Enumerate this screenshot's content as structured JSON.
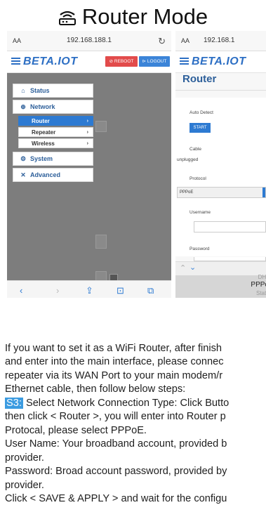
{
  "title": "Router Mode",
  "left_screen": {
    "aa": "AA",
    "url": "192.168.188.1",
    "brand": "BETA.IOT",
    "reboot": "⊘ REBOOT",
    "logout": "⊳ LOGOUT",
    "nav": {
      "status": "Status",
      "network": "Network",
      "router": "Router",
      "repeater": "Repeater",
      "wireless": "Wireless",
      "system": "System",
      "advanced": "Advanced"
    }
  },
  "right_screen": {
    "aa": "AA",
    "url": "192.168.1",
    "brand": "BETA.IOT",
    "page_title": "Router",
    "auto_detect": "Auto Detect",
    "start": "START",
    "cable": "Cable",
    "cable_status": "unplugged",
    "protocol": "Protocol",
    "protocol_value": "PPPoE",
    "username": "Username",
    "password": "Password",
    "picker_options": [
      "DHC",
      "PPPo",
      "Static"
    ]
  },
  "text": {
    "line1": "If you want to set it as a WiFi Router, after finish",
    "line2": "and enter into the main interface, please connec",
    "line3": "repeater via its WAN Port to your main modem/r",
    "line4": "Ethernet cable, then follow below steps:",
    "s3_tag": "S3:",
    "line5": " Select Network Connection Type: Click Butto",
    "line6": "then click < Router >, you will enter into Router p",
    "line7": "Protocal, please select PPPoE.",
    "line8": "User Name: Your broadband account, provided b",
    "line9": "provider.",
    "line10": "Password: Broad account password, provided by",
    "line11": "provider.",
    "line12": "Click < SAVE & APPLY > and wait for the configu"
  }
}
